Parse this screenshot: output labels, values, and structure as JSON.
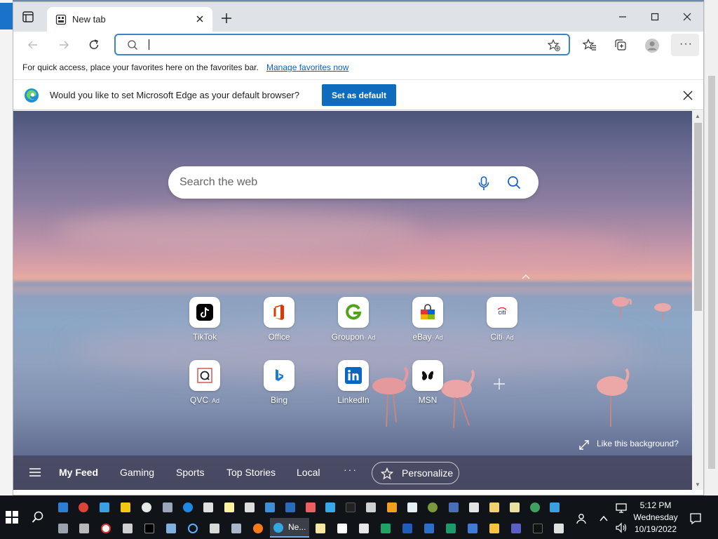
{
  "browser": {
    "tab_title": "New tab",
    "address_value": "",
    "favorites_bar_message": "For quick access, place your favorites here on the favorites bar.",
    "favorites_bar_link": "Manage favorites now",
    "infobar_message": "Would you like to set Microsoft Edge as your default browser?",
    "infobar_button": "Set as default"
  },
  "ntp": {
    "search_placeholder": "Search the web",
    "tiles": [
      {
        "label": "TikTok",
        "ad": ""
      },
      {
        "label": "Office",
        "ad": ""
      },
      {
        "label": "Groupon",
        "ad": "· Ad"
      },
      {
        "label": "eBay",
        "ad": "· Ad"
      },
      {
        "label": "Citi",
        "ad": "· Ad"
      },
      {
        "label": "QVC",
        "ad": "· Ad"
      },
      {
        "label": "Bing",
        "ad": ""
      },
      {
        "label": "LinkedIn",
        "ad": ""
      },
      {
        "label": "MSN",
        "ad": ""
      }
    ],
    "citi_icon_text": "citi",
    "like_background": "Like this background?",
    "feed": {
      "items": [
        "My Feed",
        "Gaming",
        "Sports",
        "Top Stories",
        "Local"
      ],
      "more": "···",
      "personalize": "Personalize"
    }
  },
  "taskbar": {
    "edge_label": "Ne...",
    "time": "5:12 PM",
    "day": "Wednesday",
    "date": "10/19/2022"
  },
  "desktop": {
    "help_icon_text": "?"
  },
  "colors": {
    "accent": "#0f6cbd",
    "address_border": "#3b84c7",
    "link": "#0a61c4",
    "taskbar": "#101419"
  }
}
